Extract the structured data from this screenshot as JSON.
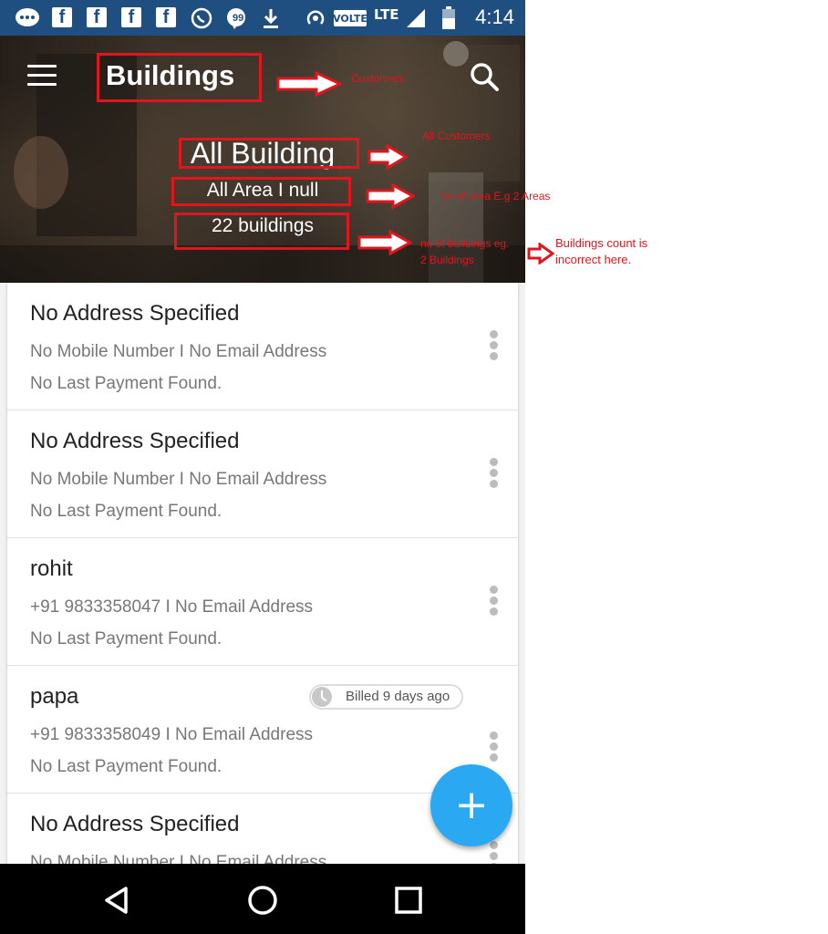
{
  "status_bar": {
    "time": "4:14",
    "volte": "VOLTE",
    "lte": "LTE"
  },
  "header": {
    "title": "Buildings",
    "filter": "All Building",
    "area": "All Area I null",
    "count": "22 buildings"
  },
  "list": {
    "items": [
      {
        "title": "No Address Specified",
        "contact": "No Mobile Number I No Email Address",
        "payment": "No Last Payment Found."
      },
      {
        "title": "No Address Specified",
        "contact": "No Mobile Number I No Email Address",
        "payment": "No Last Payment Found."
      },
      {
        "title": "rohit",
        "contact": "+91 9833358047 I No Email Address",
        "payment": "No Last Payment Found."
      },
      {
        "title": "papa",
        "contact": "+91 9833358049 I No Email Address",
        "payment": "No Last Payment Found.",
        "badge": "Billed 9 days ago"
      },
      {
        "title": "No Address Specified",
        "contact": "No Mobile Number I No Email Address",
        "payment": ""
      }
    ]
  },
  "fab": {
    "label": "+"
  },
  "annotations": {
    "title_note": "Customers",
    "filter_note": "All Customers",
    "area_note": "No of area E.g  2 Areas",
    "count_note_line1": "no of buildings eg.",
    "count_note_line2": "2 Buildings",
    "incorrect_note_line1": "Buildings count is",
    "incorrect_note_line2": "incorrect here."
  },
  "colors": {
    "status_bar": "#1f4f80",
    "annotation_red": "#e0161e",
    "fab": "#2aa8f2"
  }
}
